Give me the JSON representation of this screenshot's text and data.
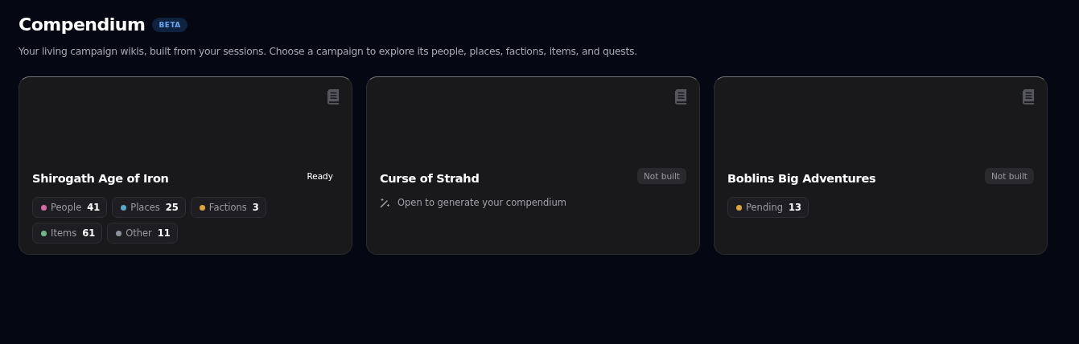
{
  "header": {
    "title": "Compendium",
    "badge": "BETA",
    "subtitle": "Your living campaign wikis, built from your sessions. Choose a campaign to explore its people, places, factions, items, and quests."
  },
  "campaigns": [
    {
      "title": "Shirogath Age of Iron",
      "status": {
        "kind": "ready",
        "label": "Ready"
      },
      "kind": "stats",
      "stats": [
        {
          "label": "People",
          "count": "41",
          "color": "#d96aa7"
        },
        {
          "label": "Places",
          "count": "25",
          "color": "#5aa7c8"
        },
        {
          "label": "Factions",
          "count": "3",
          "color": "#e0a53a"
        },
        {
          "label": "Items",
          "count": "61",
          "color": "#74b784"
        },
        {
          "label": "Other",
          "count": "11",
          "color": "#8e909c"
        }
      ]
    },
    {
      "title": "Curse of Strahd",
      "status": {
        "kind": "not_built",
        "label": "Not built"
      },
      "kind": "hint",
      "hint": "Open to generate your compendium"
    },
    {
      "title": "Boblins Big Adventures",
      "status": {
        "kind": "not_built",
        "label": "Not built"
      },
      "kind": "stats",
      "stats": [
        {
          "label": "Pending",
          "count": "13",
          "color": "#e0a53a"
        }
      ]
    }
  ]
}
